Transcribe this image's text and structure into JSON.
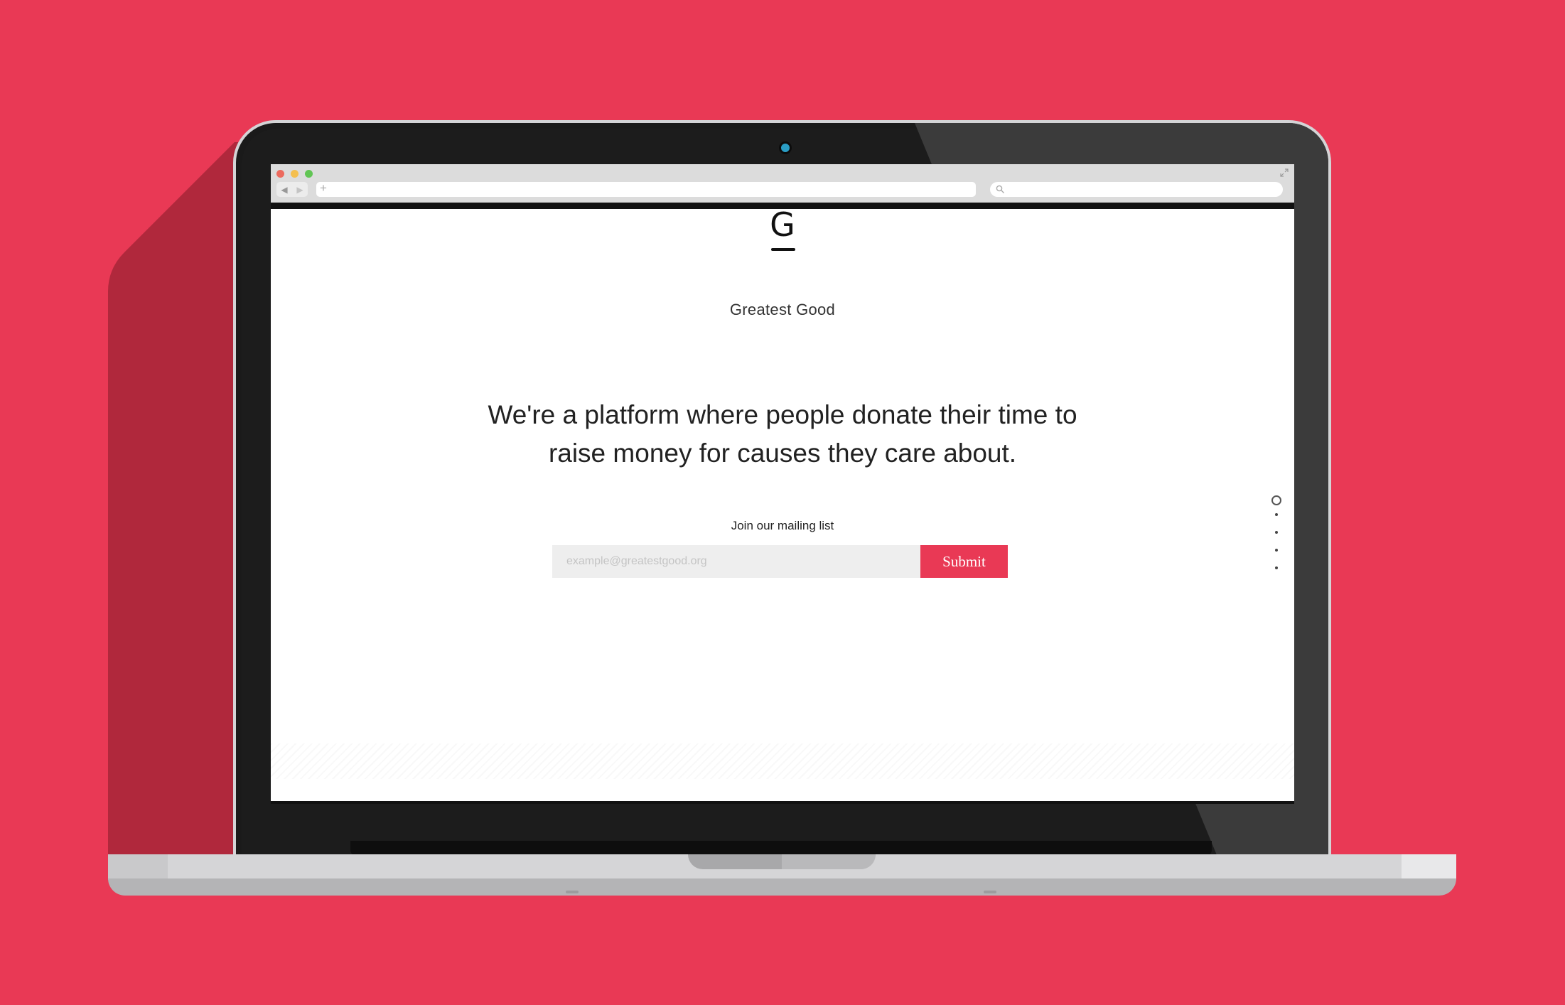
{
  "colors": {
    "background": "#e93955",
    "accent": "#e93955",
    "shadow": "#b0283c"
  },
  "browser": {
    "nav_back_icon": "back-arrow-icon",
    "nav_forward_icon": "forward-arrow-icon",
    "new_tab_icon": "plus-icon",
    "search_icon": "search-icon",
    "expand_icon": "expand-icon"
  },
  "site": {
    "logo_letter": "G",
    "brand_name": "Greatest Good",
    "headline": "We're a platform where people donate their time to raise money for causes they care about.",
    "mailing": {
      "label": "Join our mailing list",
      "email_placeholder": "example@greatestgood.org",
      "email_value": "",
      "submit_label": "Submit"
    },
    "page_indicator": {
      "total": 5,
      "active": 1
    }
  }
}
